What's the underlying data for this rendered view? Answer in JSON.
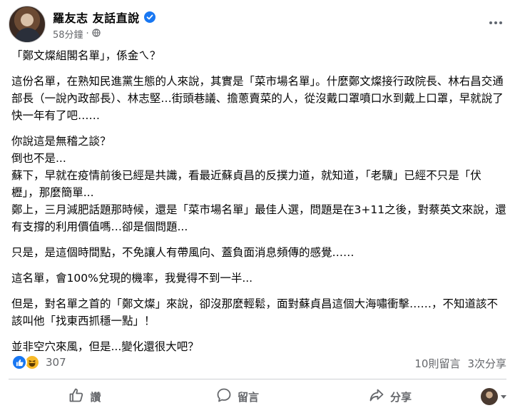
{
  "post": {
    "author": "羅友志 友話直說",
    "time": "58分鐘",
    "separator": "·",
    "paragraphs": [
      "「鄭文燦組閣名單」，係金ㄟ？",
      "這份名單，在熟知民進黨生態的人來說，其實是「菜市場名單」。什麼鄭文燦接行政院長、林右昌交通部長（一說內政部長）、林志堅…街頭巷議、擔蔥賣菜的人，從沒戴口罩噴口水到戴上口罩，早就說了快一年有了吧……",
      "你說這是無稽之談？\n倒也不是...\n蘇下，早就在疫情前後已經是共識，看最近蘇貞昌的反撲力道，就知道，「老驥」已經不只是「伏櫪」，那麼簡單...\n鄭上，三月減肥話題那時候，還是「菜市場名單」最佳人選，問題是在3+11之後，對蔡英文來說，還有支撐的利用價值嗎…卻是個問題...",
      "只是，是這個時間點，不免讓人有帶風向、蓋負面消息頻傳的感覺……",
      "這名單，會100%兌現的機率，我覺得不到一半...",
      "但是，對名單之首的「鄭文燦」來說，卻沒那麼輕鬆，面對蘇貞昌這個大海嘯衝擊……，不知道該不該叫他「找東西抓穩一點」！",
      "並非空穴來風，但是...變化還很大吧？"
    ]
  },
  "reactions": {
    "count": "307",
    "comments": "10則留言",
    "shares": "3次分享"
  },
  "actions": {
    "like": "讚",
    "comment": "留言",
    "share": "分享"
  },
  "colors": {
    "accent": "#1877f2",
    "muted_text": "#65676b",
    "haha": "#f7b928"
  },
  "icons": [
    "verified-badge-icon",
    "globe-icon",
    "more-options-icon",
    "like-reaction-icon",
    "haha-reaction-icon",
    "thumbs-up-icon",
    "comment-bubble-icon",
    "share-arrow-icon",
    "chevron-down-icon"
  ]
}
